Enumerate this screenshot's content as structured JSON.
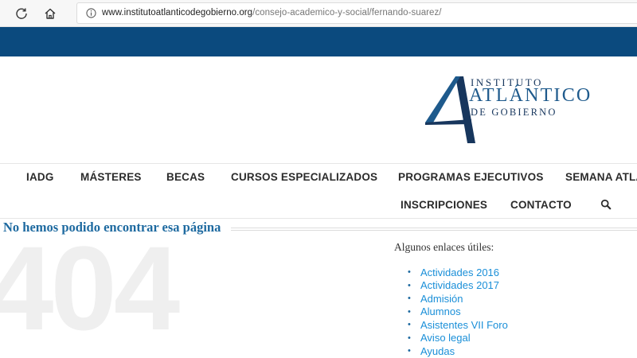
{
  "browser": {
    "url_domain": "www.institutoatlanticodegobierno.org",
    "url_path": "/consejo-academico-y-social/fernando-suarez/"
  },
  "logo": {
    "line1": "INSTITUTO",
    "line2": "ATLÁNTICO",
    "line3": "DE GOBIERNO",
    "brand_color": "#17365d"
  },
  "nav": {
    "row1": [
      "IADG",
      "MÁSTERES",
      "BECAS",
      "CURSOS ESPECIALIZADOS",
      "PROGRAMAS EJECUTIVOS",
      "SEMANA ATLÁ"
    ],
    "row2": [
      "INSCRIPCIONES",
      "CONTACTO"
    ],
    "search_icon": "search-icon"
  },
  "error": {
    "title": "No hemos podido encontrar esa página",
    "code": "404"
  },
  "links": {
    "title": "Algunos enlaces útiles:",
    "items": [
      "Actividades 2016",
      "Actividades 2017",
      "Admisión",
      "Alumnos",
      "Asistentes VII Foro",
      "Aviso legal",
      "Ayudas"
    ]
  },
  "colors": {
    "header_band": "#0b4a7e",
    "link": "#1a8fd8",
    "heading": "#1e6aa0"
  }
}
